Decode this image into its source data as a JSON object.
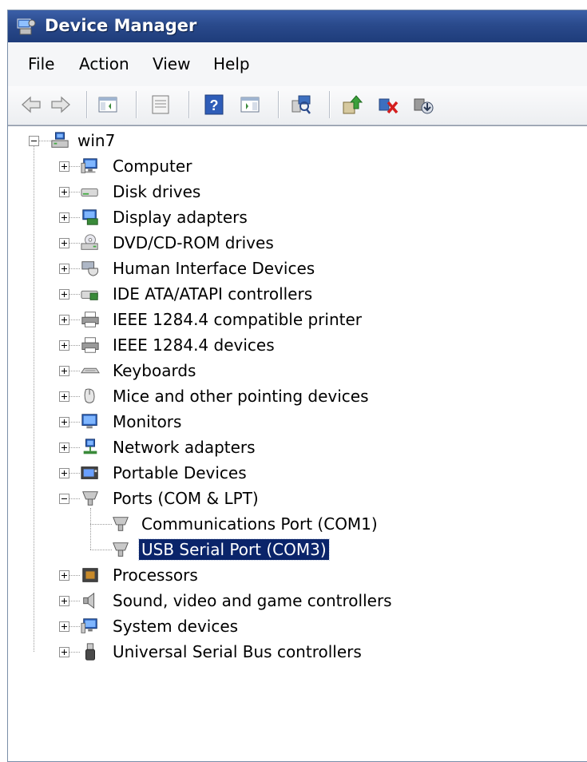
{
  "window": {
    "title": "Device Manager"
  },
  "menu": {
    "file": "File",
    "action": "Action",
    "view": "View",
    "help": "Help"
  },
  "toolbar": {
    "buttons": [
      "back-icon",
      "forward-icon",
      "show-hide-console-tree-icon",
      "properties-icon",
      "help-icon",
      "action-pane-icon",
      "scan-hardware-icon",
      "update-driver-icon",
      "uninstall-icon",
      "disable-icon"
    ]
  },
  "tree": {
    "root": "win7",
    "categories": [
      "Computer",
      "Disk drives",
      "Display adapters",
      "DVD/CD-ROM drives",
      "Human Interface Devices",
      "IDE ATA/ATAPI controllers",
      "IEEE 1284.4 compatible printer",
      "IEEE 1284.4 devices",
      "Keyboards",
      "Mice and other pointing devices",
      "Monitors",
      "Network adapters",
      "Portable Devices",
      "Ports (COM & LPT)",
      "Processors",
      "Sound, video and game controllers",
      "System devices",
      "Universal Serial Bus controllers"
    ],
    "ports_children": [
      "Communications Port (COM1)",
      "USB Serial Port (COM3)"
    ],
    "selected": "USB Serial Port (COM3)"
  }
}
